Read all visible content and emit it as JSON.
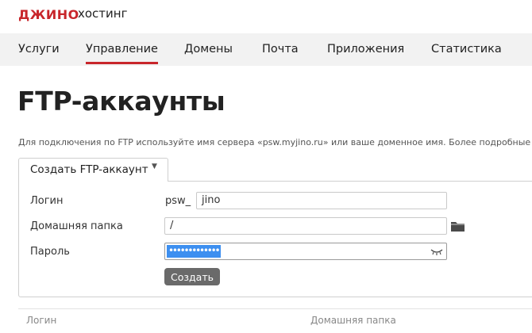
{
  "brand": {
    "logo": "ДЖИНО",
    "subtitle": "хостинг",
    "logo_color": "#c8262b"
  },
  "nav": {
    "items": [
      {
        "label": "Услуги",
        "active": false
      },
      {
        "label": "Управление",
        "active": true
      },
      {
        "label": "Домены",
        "active": false
      },
      {
        "label": "Почта",
        "active": false
      },
      {
        "label": "Приложения",
        "active": false
      },
      {
        "label": "Статистика",
        "active": false
      }
    ]
  },
  "page": {
    "title": "FTP-аккаунты",
    "info": "Для подключения по FTP используйте имя сервера «psw.myjino.ru» или ваше доменное имя. Более подробные нас"
  },
  "tab": {
    "label": "Создать FTP-аккаунт",
    "caret_icon": "caret-down-icon"
  },
  "form": {
    "login": {
      "label": "Логин",
      "prefix": "psw_",
      "value": "jino"
    },
    "folder": {
      "label": "Домашняя папка",
      "value": "/",
      "icon": "folder-icon"
    },
    "password": {
      "label": "Пароль",
      "value": "•••••••••••••",
      "icon": "eye-closed-icon"
    },
    "submit_label": "Создать"
  },
  "table": {
    "columns": [
      "Логин",
      "Домашняя папка"
    ]
  },
  "colors": {
    "accent": "#c8262b",
    "button": "#6a6a6a",
    "selection": "#3d8ff0"
  }
}
